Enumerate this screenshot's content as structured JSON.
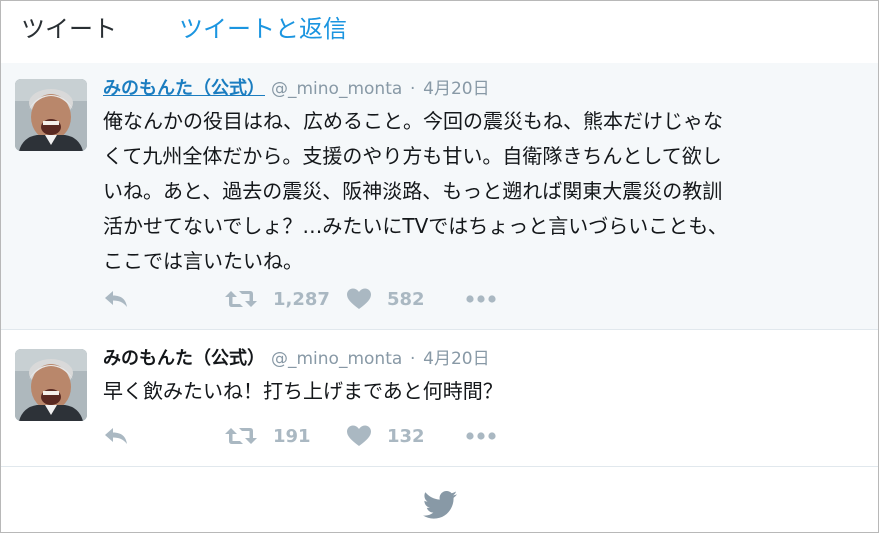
{
  "tabs": {
    "tweets": "ツイート",
    "tweets_and_replies": "ツイートと返信"
  },
  "tweets": [
    {
      "fullname": "みのもんた（公式）",
      "username": "@_mino_monta",
      "separator": "·",
      "time": "4月20日",
      "text": "俺なんかの役目はね、広めること。今回の震災もね、熊本だけじゃな\nくて九州全体だから。支援のやり方も甘い。自衛隊きちんとして欲し\nいね。あと、過去の震災、阪神淡路、もっと遡れば関東大震災の教訓\n活かせてないでしょ？…みたいにTVではちょっと言いづらいことも、\nここでは言いたいね。",
      "retweets": "1,287",
      "likes": "582"
    },
    {
      "fullname": "みのもんた（公式）",
      "username": "@_mino_monta",
      "separator": "·",
      "time": "4月20日",
      "text": "早く飲みたいね！打ち上げまであと何時間？",
      "retweets": "191",
      "likes": "132"
    }
  ],
  "icons": {
    "reply": "reply-icon",
    "retweet": "retweet-icon",
    "like": "heart-icon",
    "more": "more-icon",
    "footer": "twitter-bird-icon"
  },
  "colors": {
    "accent": "#1b95e0",
    "muted": "#aab8c2",
    "highlight_bg": "#f5f8fa"
  }
}
